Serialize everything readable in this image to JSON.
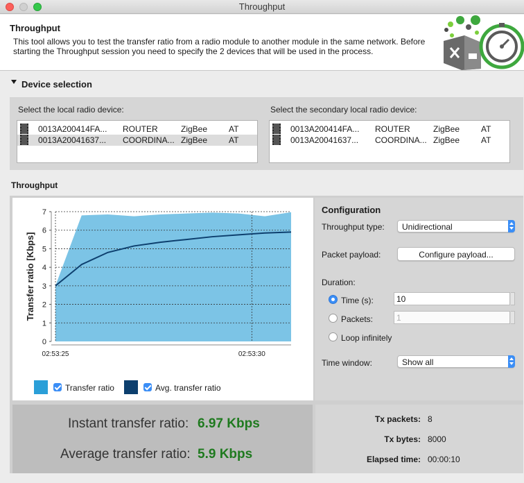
{
  "window": {
    "title": "Throughput"
  },
  "header": {
    "title": "Throughput",
    "description": "This tool allows you to test the transfer ratio from a radio module to another module in the same network. Before starting the Throughput session you need to specify the 2 devices that will be used in the process."
  },
  "device_selection": {
    "title": "Device selection",
    "local": {
      "label": "Select the local radio device:",
      "rows": [
        {
          "address": "0013A200414FA...",
          "role": "ROUTER",
          "protocol": "ZigBee",
          "mode": "AT"
        },
        {
          "address": "0013A20041637...",
          "role": "COORDINA...",
          "protocol": "ZigBee",
          "mode": "AT"
        }
      ]
    },
    "secondary": {
      "label": "Select the secondary local radio device:",
      "rows": [
        {
          "address": "0013A200414FA...",
          "role": "ROUTER",
          "protocol": "ZigBee",
          "mode": "AT"
        },
        {
          "address": "0013A20041637...",
          "role": "COORDINA...",
          "protocol": "ZigBee",
          "mode": "AT"
        }
      ]
    }
  },
  "throughput": {
    "title": "Throughput"
  },
  "chart_data": {
    "type": "area",
    "ylabel": "Transfer ratio [Kbps]",
    "xlabel": "",
    "y_ticks": [
      "0",
      "1",
      "2",
      "3",
      "4",
      "5",
      "6",
      "7"
    ],
    "ylim": [
      0,
      7
    ],
    "x_ticks": [
      "02:53:25",
      "02:53:30"
    ],
    "x": [
      0,
      1,
      2,
      3,
      4,
      5,
      6,
      7,
      8,
      9
    ],
    "series": [
      {
        "name": "Transfer ratio",
        "type": "area",
        "values": [
          3.0,
          6.8,
          6.85,
          6.75,
          6.85,
          6.9,
          6.95,
          6.9,
          6.75,
          6.97
        ]
      },
      {
        "name": "Avg. transfer ratio",
        "type": "line",
        "values": [
          3.0,
          4.15,
          4.8,
          5.15,
          5.35,
          5.5,
          5.65,
          5.75,
          5.85,
          5.9
        ]
      }
    ],
    "legend": [
      "Transfer ratio",
      "Avg. transfer ratio"
    ],
    "colors": {
      "area": "#7cc4e6",
      "line": "#0d3f6e",
      "legend_area": "#2a9fd8",
      "legend_line": "#0d3f6e"
    },
    "grid": true
  },
  "config": {
    "title": "Configuration",
    "throughput_type_label": "Throughput type:",
    "throughput_type_value": "Unidirectional",
    "packet_payload_label": "Packet payload:",
    "configure_payload_button": "Configure payload...",
    "duration_label": "Duration:",
    "time_label": "Time (s):",
    "time_value": "10",
    "packets_label": "Packets:",
    "packets_value": "1",
    "loop_label": "Loop infinitely",
    "time_window_label": "Time window:",
    "time_window_value": "Show all"
  },
  "stats": {
    "instant_label": "Instant transfer ratio:",
    "instant_value": "6.97 Kbps",
    "average_label": "Average transfer ratio:",
    "average_value": "5.9 Kbps",
    "tx_packets_label": "Tx packets:",
    "tx_packets_value": "8",
    "tx_bytes_label": "Tx bytes:",
    "tx_bytes_value": "8000",
    "elapsed_label": "Elapsed time:",
    "elapsed_value": "00:00:10"
  }
}
